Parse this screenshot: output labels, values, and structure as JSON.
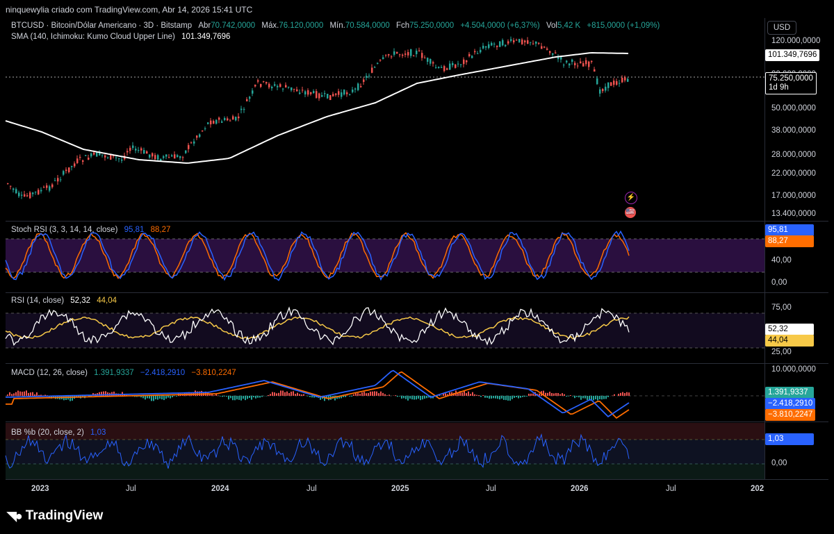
{
  "header": {
    "author_line": "ninquewylia criado com TradingView.com, Abr 14, 2026 15:41 UTC"
  },
  "symbol": {
    "title": "BTCUSD · Bitcoin/Dólar Americano · 3D · Bitstamp",
    "open_label": "Abr",
    "open": "70.742,0000",
    "high_label": "Máx.",
    "high": "76.120,0000",
    "low_label": "Mín.",
    "low": "70.584,0000",
    "close_label": "Fch",
    "close": "75.250,0000",
    "change": "+4.504,0000 (+6,37%)",
    "vol_label": "Vol",
    "vol": "5,42 K",
    "vol_change": "+815,0000 (+1,09%)"
  },
  "sma": {
    "label": "SMA (140, Ichimoku: Kumo Cloud Upper Line)",
    "value": "101.349,7696"
  },
  "currency_button": "USD",
  "price_axis": [
    "120.000,0000",
    "90.000,0000",
    "50.000,0000",
    "38.000,0000",
    "28.000,0000",
    "22.000,0000",
    "17.000,0000",
    "13.400,0000"
  ],
  "price_tags": {
    "sma": "101.349,7696",
    "last": "75.250,0000",
    "countdown": "1d 9h"
  },
  "stoch": {
    "label": "Stoch RSI (3, 3, 14, 14, close)",
    "k": "95,81",
    "d": "88,27",
    "axis": [
      "40,00",
      "0,00"
    ],
    "tag_k": "95,81",
    "tag_d": "88,27"
  },
  "rsi": {
    "label": "RSI (14, close)",
    "value": "52,32",
    "ma": "44,04",
    "axis": [
      "75,00",
      "25,00"
    ],
    "tag_value": "52,32",
    "tag_ma": "44,04"
  },
  "macd": {
    "label": "MACD (12, 26, close)",
    "hist": "1.391,9337",
    "macd": "−2.418,2910",
    "signal": "−3.810,2247",
    "axis": [
      "10.000,0000"
    ],
    "tag_hist": "1.391,9337",
    "tag_macd": "−2.418,2910",
    "tag_signal": "−3.810,2247"
  },
  "bb": {
    "label": "BB %b (20, close, 2)",
    "value": "1,03",
    "axis": [
      "0,00"
    ],
    "tag": "1,03"
  },
  "time_axis": [
    {
      "label": "2023",
      "bold": true
    },
    {
      "label": "Jul",
      "bold": false
    },
    {
      "label": "2024",
      "bold": true
    },
    {
      "label": "Jul",
      "bold": false
    },
    {
      "label": "2025",
      "bold": true
    },
    {
      "label": "Jul",
      "bold": false
    },
    {
      "label": "2026",
      "bold": true
    },
    {
      "label": "Jul",
      "bold": false
    },
    {
      "label": "202",
      "bold": true
    }
  ],
  "brand": {
    "name": "TradingView"
  },
  "colors": {
    "up": "#26a69a",
    "down": "#ef5350",
    "sma": "#ffffff",
    "stoch_k": "#2962ff",
    "stoch_d": "#ff6d00",
    "rsi": "#ffffff",
    "rsi_ma": "#f7c948",
    "macd": "#2962ff",
    "signal": "#ff6d00",
    "bb": "#2962ff"
  }
}
